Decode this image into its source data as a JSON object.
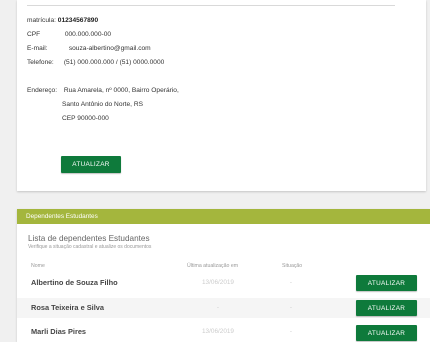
{
  "profile": {
    "matricula_label": "matrícula:",
    "matricula_value": "01234567890",
    "cpf_label": "CPF",
    "cpf_value": "000.000.000-00",
    "email_label": "E-mail:",
    "email_value": "souza-albertino@gmail.com",
    "telefone_label": "Telefone:",
    "telefone_value": "(51) 000.000.000 / (51) 0000.0000",
    "endereco_label": "Endereço:",
    "endereco_line1": "Rua Amarela, nº 0000, Bairro Operário,",
    "endereco_line2": "Santo Antônio do Norte, RS",
    "endereco_line3": "CEP 90000-000",
    "update_label": "ATUALIZAR"
  },
  "dependents": {
    "header": "Dependentes Estudantes",
    "list_title": "Lista de dependentes Estudantes",
    "list_subtitle": "Verifique a situação cadastral e atualize os documentos",
    "columns": {
      "name": "Nome",
      "last_update": "Última atualização em",
      "status": "Situação"
    },
    "rows": [
      {
        "name": "Albertino de Souza Filho",
        "last_update": "13/06/2019",
        "status": "-",
        "action": "ATUALIZAR"
      },
      {
        "name": "Rosa Teixeira e Silva",
        "last_update": "-",
        "status": "-",
        "action": "ATUALIZAR"
      },
      {
        "name": "Marli Dias Pires",
        "last_update": "13/06/2019",
        "status": "-",
        "action": "ATUALIZAR"
      }
    ]
  },
  "colors": {
    "primary_green": "#0e7a3b",
    "header_olive": "#a4b63d"
  }
}
